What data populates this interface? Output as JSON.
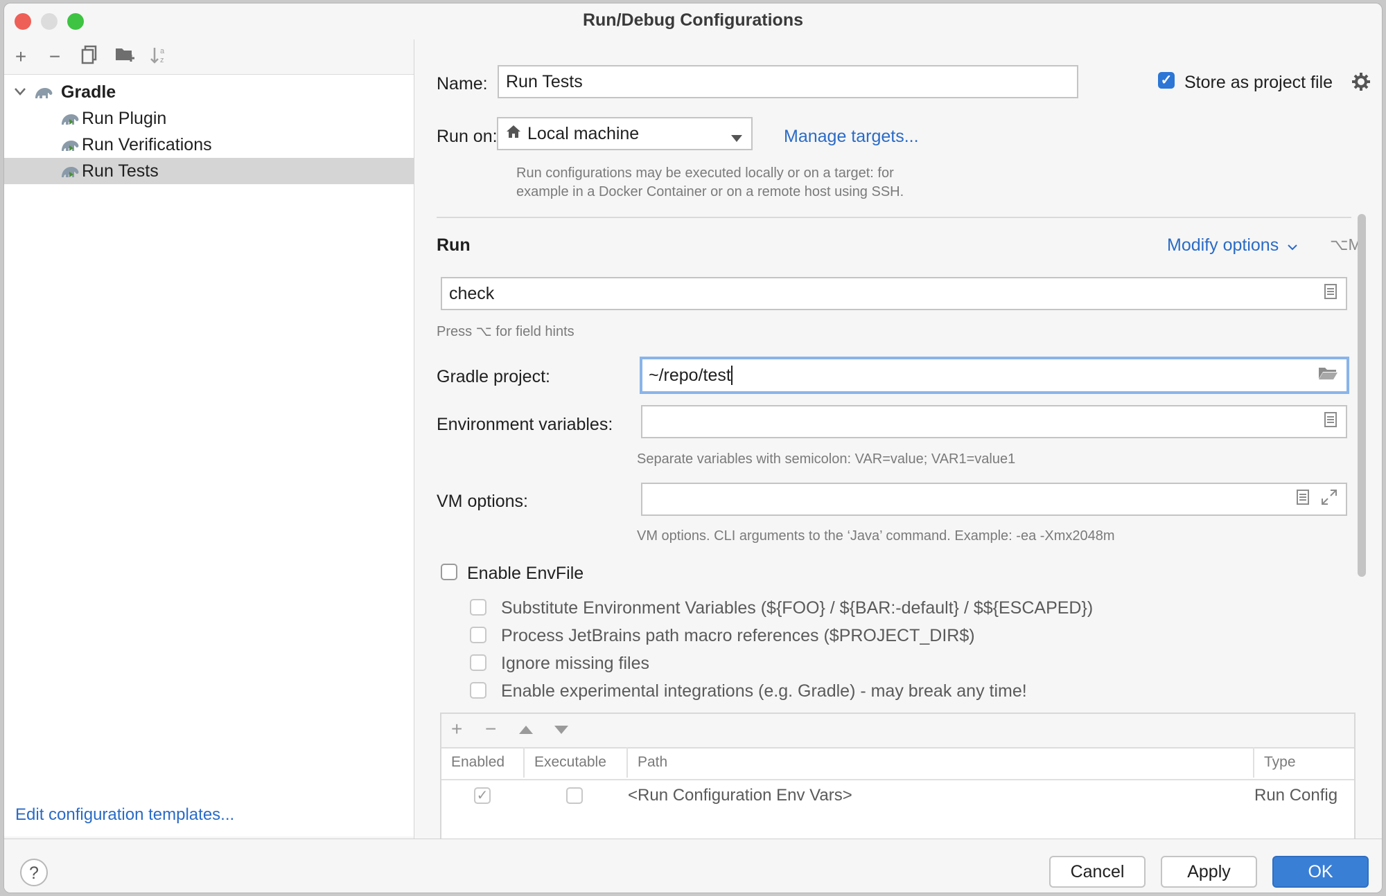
{
  "window": {
    "title": "Run/Debug Configurations"
  },
  "left_toolbar": {
    "icons": [
      "add-icon",
      "remove-icon",
      "copy-icon",
      "new-folder-icon",
      "sort-icon"
    ]
  },
  "tree": {
    "root": "Gradle",
    "items": [
      "Run Plugin",
      "Run Verifications",
      "Run Tests"
    ],
    "selected": "Run Tests"
  },
  "edit_templates_link": "Edit configuration templates...",
  "name": {
    "label": "Name:",
    "value": "Run Tests"
  },
  "store_as_project": {
    "label": "Store as project file",
    "checked": true
  },
  "run_on": {
    "label": "Run on:",
    "value": "Local machine",
    "manage_link": "Manage targets...",
    "hint_line1": "Run configurations may be executed locally or on a target: for",
    "hint_line2": "example in a Docker Container or on a remote host using SSH."
  },
  "run_section": {
    "title": "Run",
    "modify_options": "Modify options",
    "modify_shortcut": "⌥M",
    "task_value": "check",
    "field_hint": "Press ⌥ for field hints"
  },
  "gradle_project": {
    "label": "Gradle project:",
    "value": "~/repo/test"
  },
  "env_vars": {
    "label": "Environment variables:",
    "value": "",
    "hint": "Separate variables with semicolon: VAR=value; VAR1=value1"
  },
  "vm_options": {
    "label": "VM options:",
    "value": "",
    "hint": "VM options. CLI arguments to the ‘Java’ command. Example: -ea -Xmx2048m"
  },
  "envfile": {
    "enable_label": "Enable EnvFile",
    "enabled": false,
    "options": [
      "Substitute Environment Variables (${FOO} / ${BAR:-default} / $${ESCAPED})",
      "Process JetBrains path macro references ($PROJECT_DIR$)",
      "Ignore missing files",
      "Enable experimental integrations (e.g. Gradle) - may break any time!"
    ]
  },
  "env_table": {
    "columns": [
      "Enabled",
      "Executable",
      "Path",
      "Type"
    ],
    "rows": [
      {
        "enabled": true,
        "executable": false,
        "path": "<Run Configuration Env Vars>",
        "type": "Run Config"
      }
    ]
  },
  "footer": {
    "help": "?",
    "cancel": "Cancel",
    "apply": "Apply",
    "ok": "OK"
  },
  "colors": {
    "accent": "#3a7fd6",
    "link": "#2a6bc6",
    "selection": "#d5d5d5"
  }
}
